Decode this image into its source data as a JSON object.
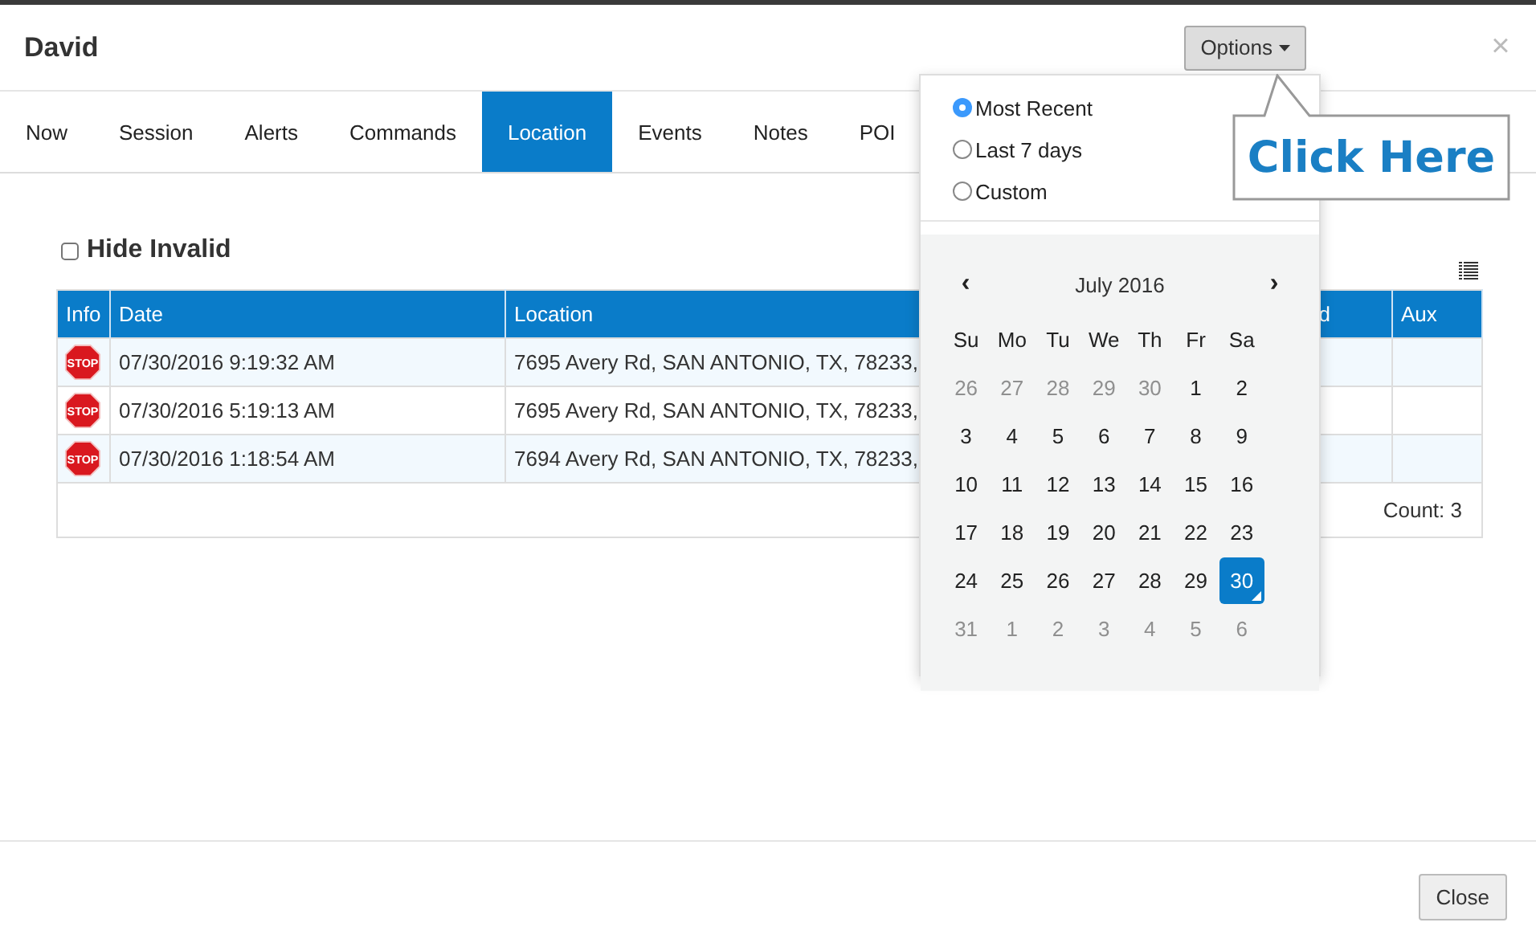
{
  "modal": {
    "title": "David",
    "options_button": "Options",
    "close_glyph": "×",
    "close_button": "Close"
  },
  "tabs": [
    {
      "label": "Now",
      "selected": false
    },
    {
      "label": "Session",
      "selected": false
    },
    {
      "label": "Alerts",
      "selected": false
    },
    {
      "label": "Commands",
      "selected": false
    },
    {
      "label": "Location",
      "selected": true
    },
    {
      "label": "Events",
      "selected": false
    },
    {
      "label": "Notes",
      "selected": false
    },
    {
      "label": "POI",
      "selected": false
    }
  ],
  "filter": {
    "label": "Hide Invalid",
    "checked": false
  },
  "table": {
    "columns": [
      "Info",
      "Date",
      "Location",
      "d",
      "Aux"
    ],
    "rows": [
      {
        "badge": "STOP",
        "date": "07/30/2016 9:19:32 AM",
        "location": "7695 Avery Rd, SAN ANTONIO, TX, 78233,"
      },
      {
        "badge": "STOP",
        "date": "07/30/2016 5:19:13 AM",
        "location": "7695 Avery Rd, SAN ANTONIO, TX, 78233,"
      },
      {
        "badge": "STOP",
        "date": "07/30/2016 1:18:54 AM",
        "location": "7694 Avery Rd, SAN ANTONIO, TX, 78233,"
      }
    ],
    "count": "Count: 3"
  },
  "popup": {
    "ranges": [
      {
        "label": "Most Recent",
        "selected": true
      },
      {
        "label": "Last 7 days",
        "selected": false
      },
      {
        "label": "Custom",
        "selected": false
      }
    ],
    "calendar": {
      "prev": "‹",
      "next": "›",
      "month": "July 2016",
      "weekdays": [
        "Su",
        "Mo",
        "Tu",
        "We",
        "Th",
        "Fr",
        "Sa"
      ],
      "weeks": [
        [
          {
            "day": "26",
            "muted": true,
            "selected": false
          },
          {
            "day": "27",
            "muted": true,
            "selected": false
          },
          {
            "day": "28",
            "muted": true,
            "selected": false
          },
          {
            "day": "29",
            "muted": true,
            "selected": false
          },
          {
            "day": "30",
            "muted": true,
            "selected": false
          },
          {
            "day": "1",
            "muted": false,
            "selected": false
          },
          {
            "day": "2",
            "muted": false,
            "selected": false
          }
        ],
        [
          {
            "day": "3",
            "muted": false,
            "selected": false
          },
          {
            "day": "4",
            "muted": false,
            "selected": false
          },
          {
            "day": "5",
            "muted": false,
            "selected": false
          },
          {
            "day": "6",
            "muted": false,
            "selected": false
          },
          {
            "day": "7",
            "muted": false,
            "selected": false
          },
          {
            "day": "8",
            "muted": false,
            "selected": false
          },
          {
            "day": "9",
            "muted": false,
            "selected": false
          }
        ],
        [
          {
            "day": "10",
            "muted": false,
            "selected": false
          },
          {
            "day": "11",
            "muted": false,
            "selected": false
          },
          {
            "day": "12",
            "muted": false,
            "selected": false
          },
          {
            "day": "13",
            "muted": false,
            "selected": false
          },
          {
            "day": "14",
            "muted": false,
            "selected": false
          },
          {
            "day": "15",
            "muted": false,
            "selected": false
          },
          {
            "day": "16",
            "muted": false,
            "selected": false
          }
        ],
        [
          {
            "day": "17",
            "muted": false,
            "selected": false
          },
          {
            "day": "18",
            "muted": false,
            "selected": false
          },
          {
            "day": "19",
            "muted": false,
            "selected": false
          },
          {
            "day": "20",
            "muted": false,
            "selected": false
          },
          {
            "day": "21",
            "muted": false,
            "selected": false
          },
          {
            "day": "22",
            "muted": false,
            "selected": false
          },
          {
            "day": "23",
            "muted": false,
            "selected": false
          }
        ],
        [
          {
            "day": "24",
            "muted": false,
            "selected": false
          },
          {
            "day": "25",
            "muted": false,
            "selected": false
          },
          {
            "day": "26",
            "muted": false,
            "selected": false
          },
          {
            "day": "27",
            "muted": false,
            "selected": false
          },
          {
            "day": "28",
            "muted": false,
            "selected": false
          },
          {
            "day": "29",
            "muted": false,
            "selected": false
          },
          {
            "day": "30",
            "muted": false,
            "selected": true
          }
        ],
        [
          {
            "day": "31",
            "muted": true,
            "selected": false
          },
          {
            "day": "1",
            "muted": true,
            "selected": false
          },
          {
            "day": "2",
            "muted": true,
            "selected": false
          },
          {
            "day": "3",
            "muted": true,
            "selected": false
          },
          {
            "day": "4",
            "muted": true,
            "selected": false
          },
          {
            "day": "5",
            "muted": true,
            "selected": false
          },
          {
            "day": "6",
            "muted": true,
            "selected": false
          }
        ]
      ]
    }
  },
  "callout": {
    "text": "Click Here"
  }
}
